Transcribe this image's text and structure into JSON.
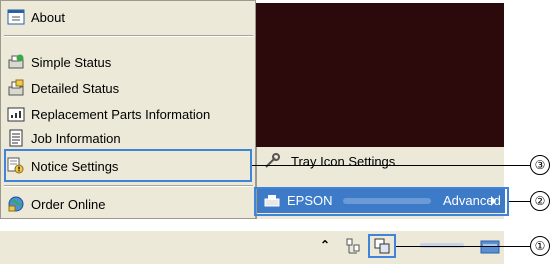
{
  "menu": {
    "items": [
      {
        "label": "About",
        "icon": "about-window-icon"
      },
      {
        "label": "Simple Status",
        "icon": "simple-status-icon"
      },
      {
        "label": "Detailed Status",
        "icon": "detailed-status-icon"
      },
      {
        "label": "Replacement Parts Information",
        "icon": "replacement-parts-icon"
      },
      {
        "label": "Job Information",
        "icon": "job-information-icon"
      },
      {
        "label": "Notice Settings",
        "icon": "notice-settings-icon"
      },
      {
        "label": "Order Online",
        "icon": "order-online-icon"
      }
    ]
  },
  "submenu": {
    "tray_label": "Tray Icon Settings",
    "printer_brand": "EPSON",
    "printer_mode": "Advanced"
  },
  "callouts": {
    "c1": "①",
    "c2": "②",
    "c3": "③"
  },
  "colors": {
    "menu_bg": "#ece9d8",
    "highlight": "#3d7bc9",
    "dark_area": "#2c0a0c",
    "outline": "#3f84d8"
  }
}
